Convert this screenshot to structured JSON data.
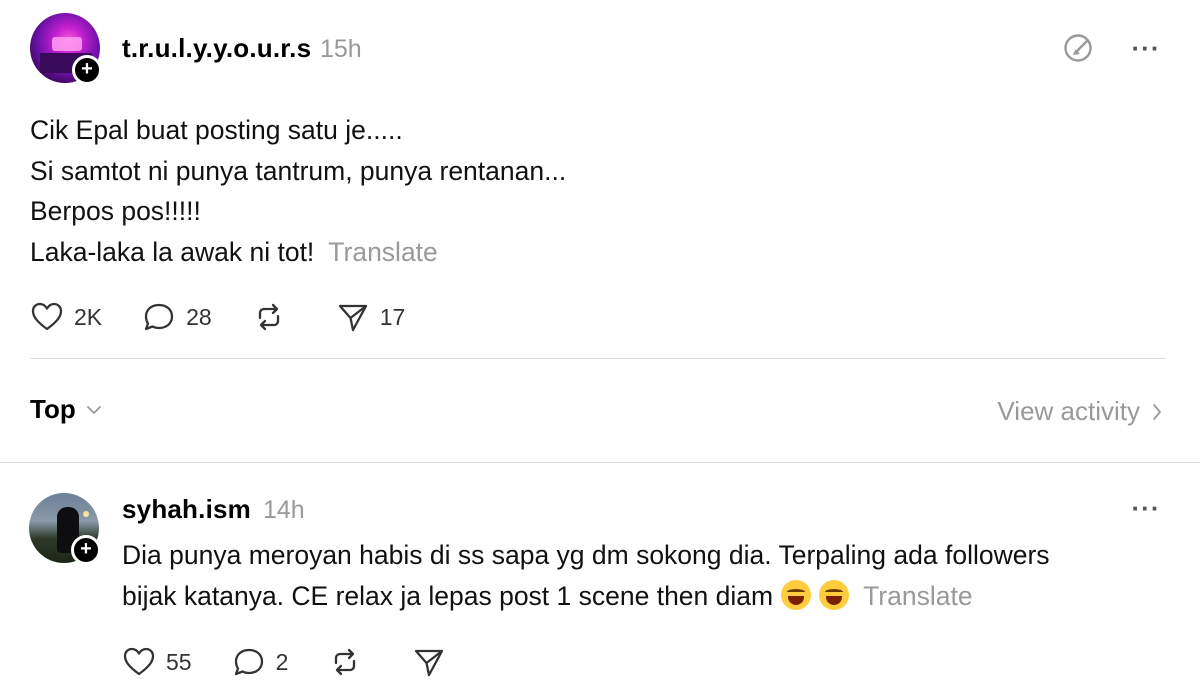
{
  "post": {
    "username": "t.r.u.l.y.y.o.u.r.s",
    "time": "15h",
    "lines": [
      "Cik Epal buat posting satu je.....",
      "Si samtot ni punya tantrum, punya rentanan...",
      "Berpos pos!!!!!",
      "Laka-laka la awak ni tot!"
    ],
    "translate_label": "Translate",
    "likes": "2K",
    "replies": "28",
    "shares": "17"
  },
  "sort": {
    "label": "Top",
    "view_activity": "View activity"
  },
  "reply": {
    "username": "syhah.ism",
    "time": "14h",
    "text_line1": "Dia punya meroyan habis di ss sapa yg dm sokong dia. Terpaling ada followers",
    "text_line2": "bijak katanya. CE relax ja lepas post 1 scene then diam",
    "translate_label": "Translate",
    "likes": "55",
    "replies": "2"
  },
  "icons": {
    "like": "heart-icon",
    "reply": "comment-icon",
    "repost": "repost-icon",
    "share": "send-icon",
    "more": "more-icon",
    "edit": "edit-icon"
  }
}
